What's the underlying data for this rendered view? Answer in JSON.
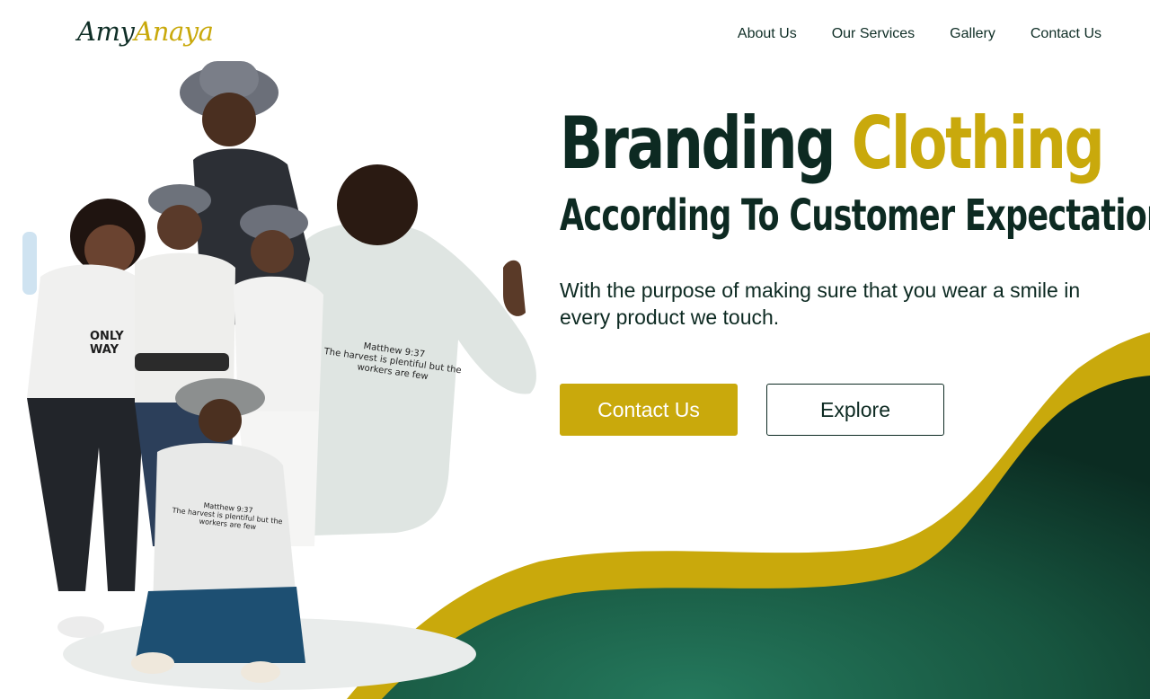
{
  "brand": {
    "first": "Amy",
    "last": "Anaya"
  },
  "nav": {
    "items": [
      {
        "label": "About Us"
      },
      {
        "label": "Our Services"
      },
      {
        "label": "Gallery"
      },
      {
        "label": "Contact Us"
      }
    ]
  },
  "hero": {
    "headline_word_1": "Branding",
    "headline_word_2": "Clothing",
    "subheadline": "According To Customer Expectations",
    "tagline": "With the purpose of making sure that you wear a smile in every product we touch.",
    "primary_button": "Contact Us",
    "secondary_button": "Explore"
  },
  "photo": {
    "shirt_back_text": "Matthew 9:37\nThe harvest is plentiful but the\nworkers are few"
  },
  "colors": {
    "accent_gold": "#c9a90c",
    "dark_green": "#0d2a22",
    "wave_green": "#1f6b52"
  }
}
